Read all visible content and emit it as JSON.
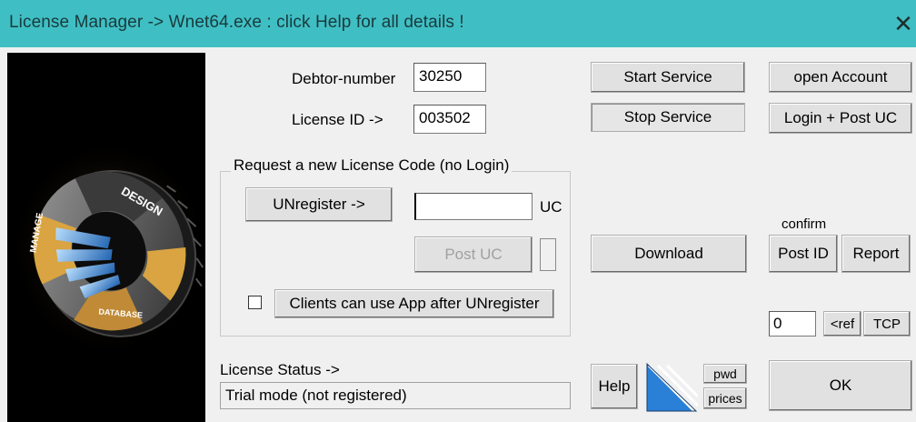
{
  "window": {
    "title": "License Manager -> Wnet64.exe : click Help for all details !",
    "close_glyph": "✕"
  },
  "logo": {
    "ring_labels": [
      "MANAGE",
      "DESIGN",
      "DATABASE"
    ]
  },
  "fields": {
    "debtor_label": "Debtor-number",
    "debtor_value": "30250",
    "license_id_label": "License ID  ->",
    "license_id_value": "003502",
    "uc_value": "",
    "uc_label": "UC",
    "counter_value": "0"
  },
  "group": {
    "title": "Request a new License Code (no Login)",
    "unregister_label": "UNregister ->",
    "post_uc_label": "Post UC",
    "clients_checkbox_checked": false,
    "clients_label": "Clients can use App after UNregister"
  },
  "buttons": {
    "start_service": "Start Service",
    "stop_service": "Stop Service",
    "open_account": "open Account",
    "login_post_uc": "Login + Post UC",
    "download": "Download",
    "confirm_label": "confirm",
    "post_id": "Post ID",
    "report": "Report",
    "ref": "<ref",
    "tcp": "TCP",
    "help": "Help",
    "pwd": "pwd",
    "prices": "prices",
    "ok": "OK"
  },
  "status": {
    "label": "License Status ->",
    "value": "Trial mode (not registered)"
  },
  "icons": {
    "close": "close-icon",
    "logo": "gear-logo-icon",
    "brand": "stripes-brand-icon"
  },
  "colors": {
    "titlebar": "#3fbfc4",
    "dialog": "#f0f0f0",
    "logo_background": "#000000",
    "logo_accent": "#d9a441",
    "brand_blue": "#2a7fd6"
  }
}
